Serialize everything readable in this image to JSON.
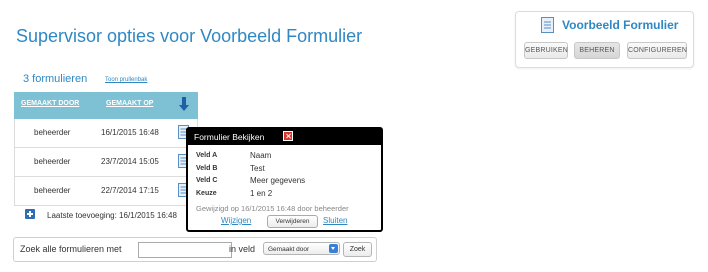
{
  "page": {
    "title": "Supervisor opties voor Voorbeeld Formulier"
  },
  "widget": {
    "title": "Voorbeeld Formulier",
    "icon": "document-icon",
    "buttons": [
      "GEBRUIKEN",
      "BEHEREN",
      "CONFIGUREREN"
    ],
    "active_button": "BEHEREN"
  },
  "forms": {
    "count_label": "3 formulieren",
    "trash_link": "Toon prullenbak",
    "columns": [
      "GEMAAKT DOOR",
      "GEMAAKT OP"
    ],
    "sort_icon": "sort-down-arrow-icon",
    "rows": [
      {
        "created_by": "beheerder",
        "created_on": "16/1/2015 16:48"
      },
      {
        "created_by": "beheerder",
        "created_on": "23/7/2014 15:05"
      },
      {
        "created_by": "beheerder",
        "created_on": "22/7/2014 17:15"
      }
    ],
    "last_added": "Laatste toevoeging: 16/1/2015 16:48"
  },
  "search": {
    "label_prefix": "Zoek alle formulieren met",
    "input_value": "",
    "label_field": "in veld",
    "field_selected": "Gemaakt door",
    "button": "Zoek"
  },
  "popup": {
    "title": "Formulier Bekijken",
    "fields": [
      {
        "label": "Veld A",
        "value": "Naam"
      },
      {
        "label": "Veld B",
        "value": "Test"
      },
      {
        "label": "Veld C",
        "value": "Meer gegevens"
      },
      {
        "label": "Keuze",
        "value": "1 en 2"
      }
    ],
    "meta": "Gewijzigd op 16/1/2015 16:48 door beheerder",
    "edit_link": "Wijzigen",
    "delete_button": "Verwijderen",
    "close_link": "Sluiten"
  },
  "colors": {
    "accent": "#2f88c3",
    "table_header": "#7ec0d4",
    "close_red": "#d9352a"
  }
}
